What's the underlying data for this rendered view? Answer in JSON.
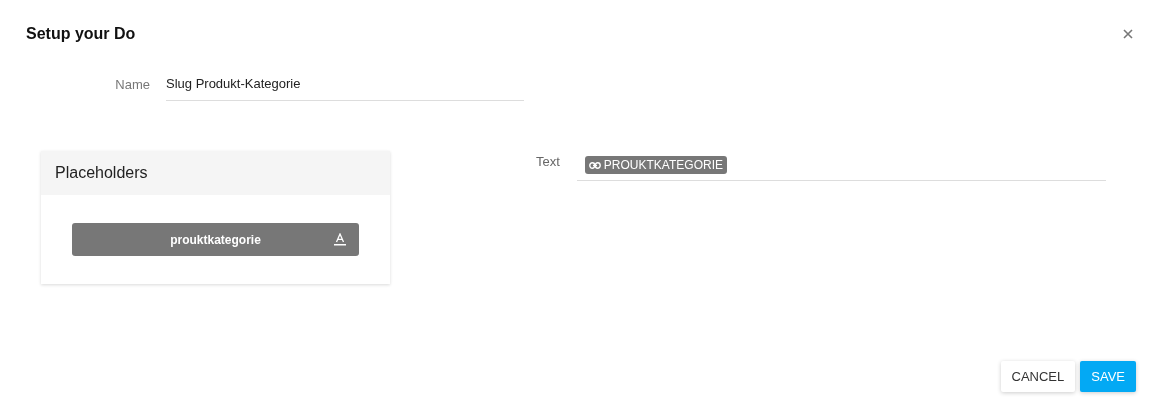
{
  "dialog": {
    "title": "Setup your Do"
  },
  "name_field": {
    "label": "Name",
    "value": "Slug Produkt-Kategorie"
  },
  "placeholders": {
    "title": "Placeholders",
    "items": [
      {
        "label": "prouktkategorie"
      }
    ]
  },
  "text_field": {
    "label": "Text",
    "chips": [
      {
        "label": "PROUKTKATEGORIE"
      }
    ]
  },
  "buttons": [
    {
      "label": "CANCEL",
      "kind": "secondary"
    },
    {
      "label": "SAVE",
      "kind": "primary"
    }
  ]
}
